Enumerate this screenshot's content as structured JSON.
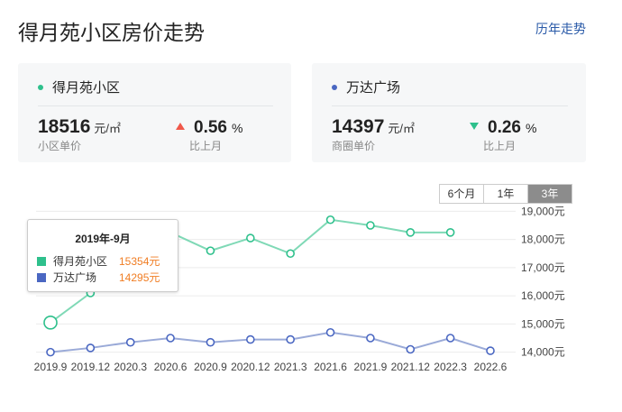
{
  "page": {
    "title": "得月苑小区房价走势",
    "history_link": "历年走势"
  },
  "cards": [
    {
      "name": "得月苑小区",
      "dot_color": "#2ec08c",
      "price": "18516",
      "unit": "元/㎡",
      "price_label": "小区单价",
      "direction": "up",
      "change": "0.56",
      "change_unit": "%",
      "change_label": "比上月"
    },
    {
      "name": "万达广场",
      "dot_color": "#4a67c2",
      "price": "14397",
      "unit": "元/㎡",
      "price_label": "商圈单价",
      "direction": "down",
      "change": "0.26",
      "change_unit": "%",
      "change_label": "比上月"
    }
  ],
  "range_tabs": [
    "6个月",
    "1年",
    "3年"
  ],
  "active_range": "3年",
  "tooltip": {
    "title": "2019年-9月",
    "rows": [
      {
        "name": "得月苑小区",
        "value": "15354元",
        "color": "#2ec08c"
      },
      {
        "name": "万达广场",
        "value": "14295元",
        "color": "#4a67c2"
      }
    ]
  },
  "chart_data": {
    "type": "line",
    "x": [
      "2019.9",
      "2019.12",
      "2020.3",
      "2020.6",
      "2020.9",
      "2020.12",
      "2021.3",
      "2021.6",
      "2021.9",
      "2021.12",
      "2022.3",
      "2022.6"
    ],
    "series": [
      {
        "name": "得月苑小区",
        "color": "#7fd9b6",
        "marker_color": "#2ec08c",
        "values": [
          15050,
          16100,
          17150,
          18250,
          17600,
          18050,
          17500,
          18700,
          18500,
          18250,
          18250
        ]
      },
      {
        "name": "万达广场",
        "color": "#9aaad8",
        "marker_color": "#4a67c2",
        "values": [
          14000,
          14150,
          14350,
          14500,
          14350,
          14450,
          14450,
          14700,
          14500,
          14100,
          14500,
          14050
        ]
      }
    ],
    "y_ticks": [
      14000,
      15000,
      16000,
      17000,
      18000,
      19000
    ],
    "y_tick_labels": [
      "14,000元",
      "15,000元",
      "16,000元",
      "17,000元",
      "18,000元",
      "19,000元"
    ],
    "ylim": [
      13700,
      19300
    ],
    "grid": true,
    "highlight_index": 0
  }
}
